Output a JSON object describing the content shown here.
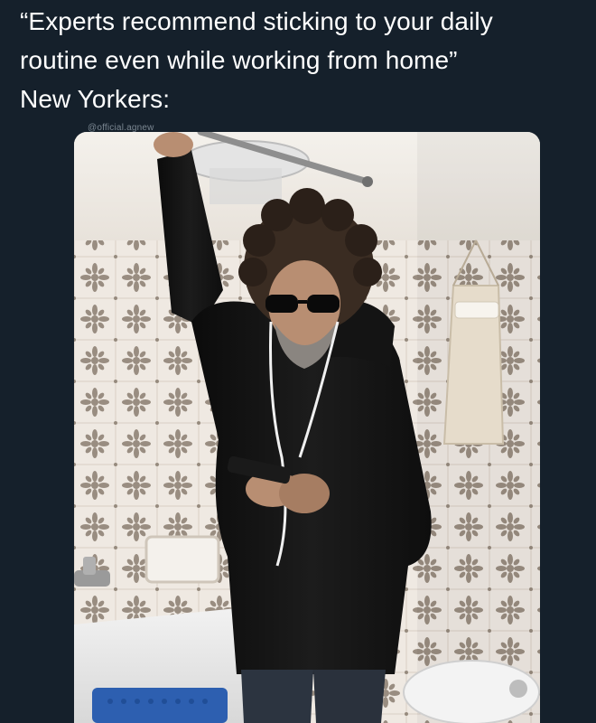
{
  "meme": {
    "caption_lines": [
      "“Experts recommend sticking to your daily",
      "routine even while working from home”",
      "New Yorkers:"
    ],
    "watermark": "@official.agnew"
  },
  "photo": {
    "description_icon": "photo-man-in-bathtub-holding-shower-rod",
    "colors": {
      "background": "#15202b",
      "tile": "#efe9e2",
      "tile_pattern": "#8a7d70",
      "jacket": "#111111",
      "hair": "#3a2c22",
      "skin": "#b88e72"
    }
  }
}
